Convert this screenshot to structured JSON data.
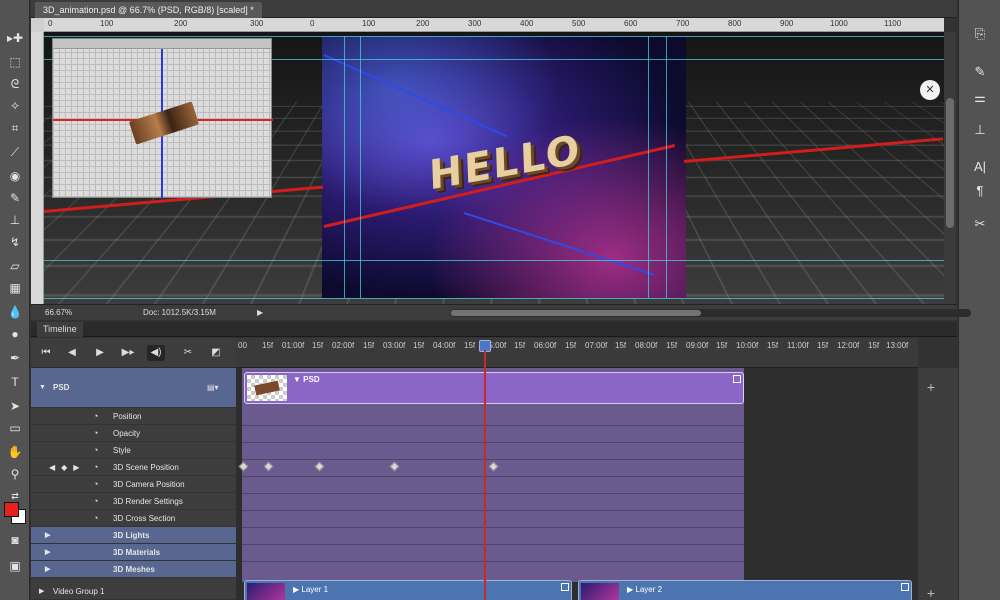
{
  "document": {
    "tab_title": "3D_animation.psd @ 66.7% (PSD, RGB/8) [scaled] *",
    "zoom": "66.67%",
    "doc_info": "Doc: 1012.5K/3.15M",
    "canvas_text": "HELLO"
  },
  "ruler": {
    "ticks": [
      "0",
      "100",
      "200",
      "300",
      "0",
      "100",
      "200",
      "300",
      "400",
      "500",
      "600",
      "700",
      "800",
      "900",
      "1000",
      "1100"
    ]
  },
  "timeline": {
    "panel_title": "Timeline",
    "time_marks": [
      "00",
      "15f",
      "01:00f",
      "15f",
      "02:00f",
      "15f",
      "03:00f",
      "15f",
      "04:00f",
      "15f",
      "05:00f",
      "15f",
      "06:00f",
      "15f",
      "07:00f",
      "15f",
      "08:00f",
      "15f",
      "09:00f",
      "15f",
      "10:00f",
      "15f",
      "11:00f",
      "15f",
      "12:00f",
      "15f",
      "13:00f"
    ],
    "layer_psd": "PSD",
    "properties": [
      "Position",
      "Opacity",
      "Style",
      "3D Scene Position",
      "3D Camera Position",
      "3D Render Settings",
      "3D Cross Section"
    ],
    "groups": [
      "3D Lights",
      "3D Materials",
      "3D Meshes"
    ],
    "video_group": "Video Group 1",
    "clip_psd": "PSD",
    "clip_layer1": "Layer 1",
    "clip_layer2": "Layer 2"
  },
  "colors": {
    "foreground": "#e52222",
    "background": "#ffffff",
    "accent": "#586790"
  }
}
